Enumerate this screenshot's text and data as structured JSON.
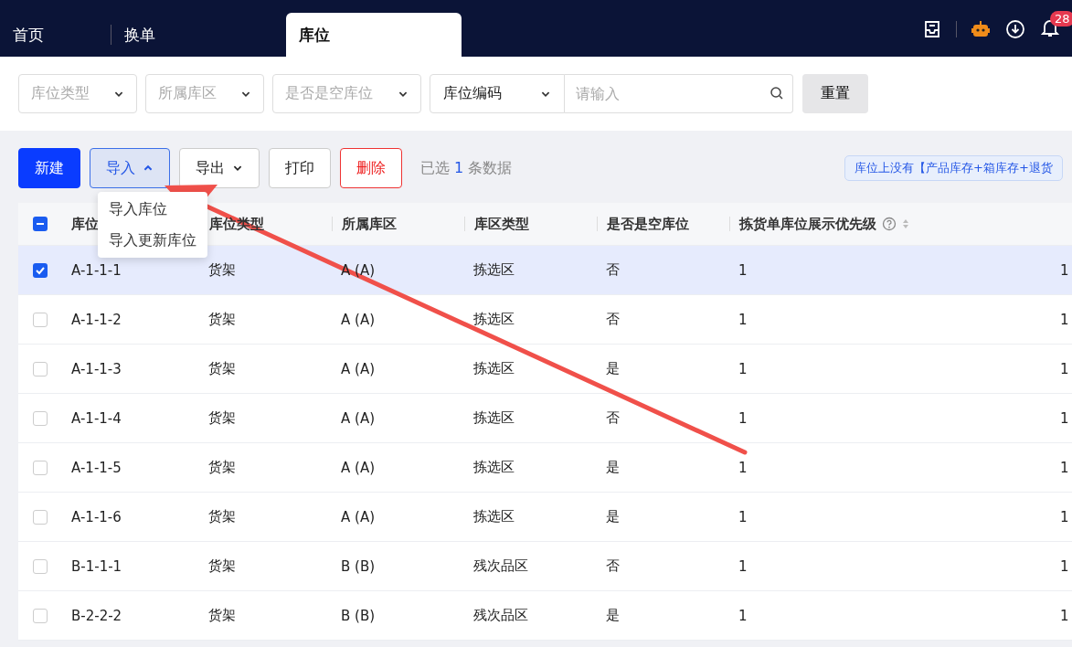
{
  "nav": {
    "tabs": [
      {
        "label": "首页",
        "selected": false
      },
      {
        "label": "换单",
        "selected": false
      },
      {
        "label": "库位",
        "selected": true
      }
    ],
    "notification_count": "28"
  },
  "filters": {
    "selects": [
      {
        "placeholder": "库位类型"
      },
      {
        "placeholder": "所属库区"
      },
      {
        "placeholder": "是否是空库位"
      }
    ],
    "field_select": "库位编码",
    "search": {
      "placeholder": "请输入"
    },
    "reset": "重置"
  },
  "toolbar": {
    "buttons": [
      {
        "label": "新建",
        "kind": "primary"
      },
      {
        "label": "导入",
        "kind": "dropdown_open"
      },
      {
        "label": "导出",
        "kind": "dropdown"
      },
      {
        "label": "打印",
        "kind": "default"
      },
      {
        "label": "删除",
        "kind": "danger"
      }
    ],
    "selection_prefix": "已选",
    "selection_count": "1",
    "selection_suffix": "条数据",
    "notice": "库位上没有【产品库存+箱库存+退货"
  },
  "dropdown": {
    "items": [
      "导入库位",
      "导入更新库位"
    ]
  },
  "table": {
    "select_all_indeterminate": true,
    "columns": [
      {
        "label": "库位"
      },
      {
        "label": "库位类型"
      },
      {
        "label": "所属库区"
      },
      {
        "label": "库区类型"
      },
      {
        "label": "是否是空库位"
      },
      {
        "label": "拣货单库位展示优先级",
        "sortable": true,
        "help": true
      }
    ],
    "rows": [
      {
        "selected": true,
        "cells": [
          "A-1-1-1",
          "货架",
          "A (A)",
          "拣选区",
          "否",
          "1",
          "1"
        ]
      },
      {
        "selected": false,
        "cells": [
          "A-1-1-2",
          "货架",
          "A (A)",
          "拣选区",
          "否",
          "1",
          "1"
        ]
      },
      {
        "selected": false,
        "cells": [
          "A-1-1-3",
          "货架",
          "A (A)",
          "拣选区",
          "是",
          "1",
          "1"
        ]
      },
      {
        "selected": false,
        "cells": [
          "A-1-1-4",
          "货架",
          "A (A)",
          "拣选区",
          "否",
          "1",
          "1"
        ]
      },
      {
        "selected": false,
        "cells": [
          "A-1-1-5",
          "货架",
          "A (A)",
          "拣选区",
          "是",
          "1",
          "1"
        ]
      },
      {
        "selected": false,
        "cells": [
          "A-1-1-6",
          "货架",
          "A (A)",
          "拣选区",
          "是",
          "1",
          "1"
        ]
      },
      {
        "selected": false,
        "cells": [
          "B-1-1-1",
          "货架",
          "B (B)",
          "残次品区",
          "否",
          "1",
          "1"
        ]
      },
      {
        "selected": false,
        "cells": [
          "B-2-2-2",
          "货架",
          "B (B)",
          "残次品区",
          "是",
          "1",
          "1"
        ]
      }
    ]
  }
}
